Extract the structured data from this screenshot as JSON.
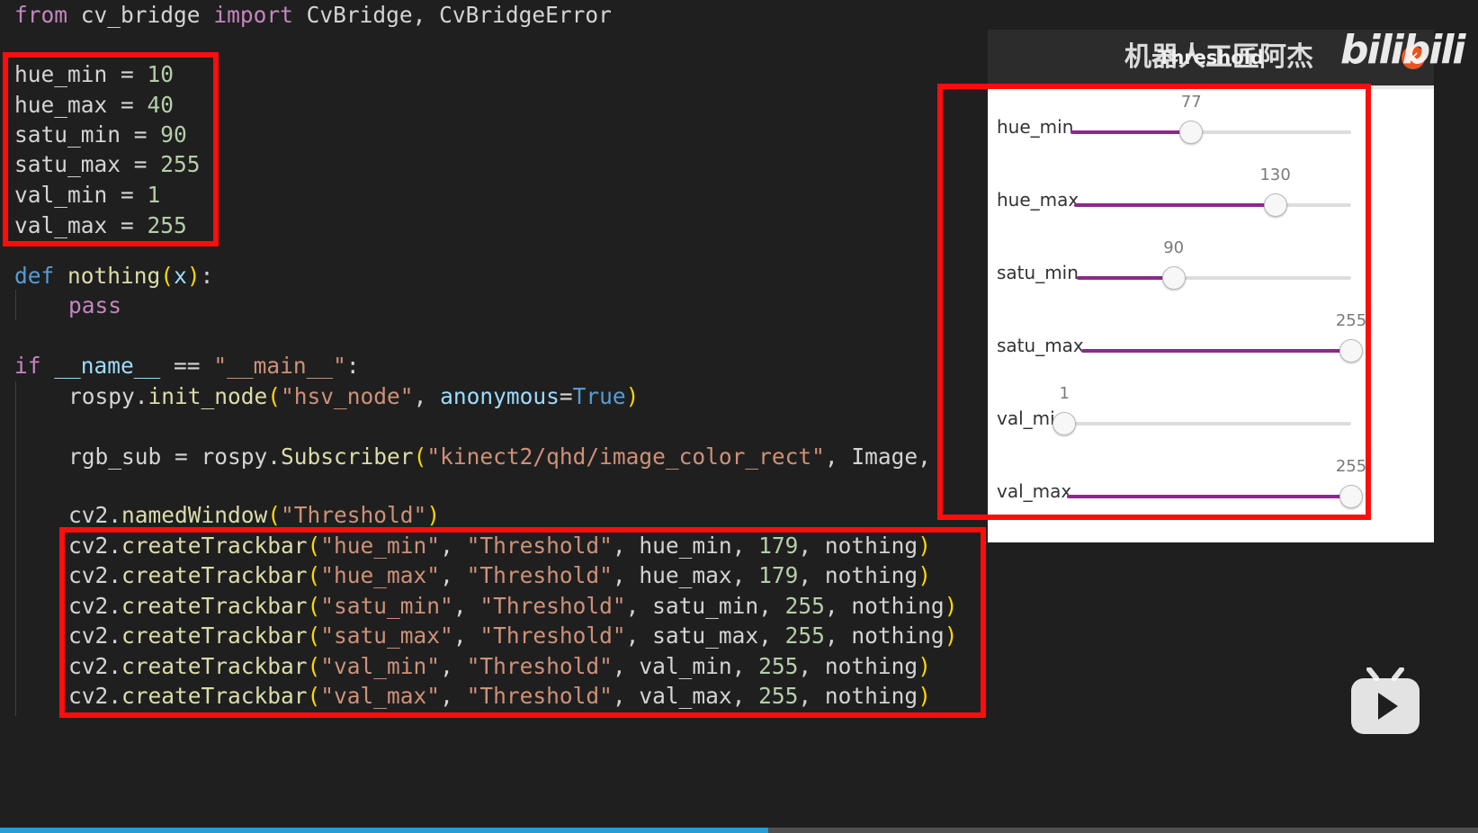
{
  "code": {
    "import_line": {
      "kw_from": "from",
      "module": "cv_bridge",
      "kw_import": "import",
      "names": "CvBridge, CvBridgeError"
    },
    "assignments": [
      {
        "name": "hue_min",
        "op": " = ",
        "value": "10"
      },
      {
        "name": "hue_max",
        "op": " = ",
        "value": "40"
      },
      {
        "name": "satu_min",
        "op": " = ",
        "value": "90"
      },
      {
        "name": "satu_max",
        "op": " = ",
        "value": "255"
      },
      {
        "name": "val_min",
        "op": " = ",
        "value": "1"
      },
      {
        "name": "val_max",
        "op": " = ",
        "value": "255"
      }
    ],
    "def_line": {
      "kw": "def",
      "fn": "nothing",
      "param": "x"
    },
    "pass_line": "pass",
    "if_line": {
      "kw": "if",
      "name_var": "__name__",
      "op": " == ",
      "str": "\"__main__\"",
      "colon": ":"
    },
    "init_node": {
      "obj": "rospy.",
      "fn": "init_node",
      "str": "\"hsv_node\"",
      "kwarg": "anonymous",
      "eq": "=",
      "const": "True"
    },
    "subscriber": {
      "var": "rgb_sub",
      "op": " = ",
      "obj": "rospy.",
      "fn": "Subscriber",
      "str": "\"kinect2/qhd/image_color_rect\"",
      "tail": ", Image,"
    },
    "named_window": {
      "obj": "cv2.",
      "fn": "namedWindow",
      "str": "\"Threshold\""
    },
    "trackbars": [
      {
        "name_str": "\"hue_min\"",
        "win_str": "\"Threshold\"",
        "var": "hue_min",
        "max": "179",
        "cb": "nothing"
      },
      {
        "name_str": "\"hue_max\"",
        "win_str": "\"Threshold\"",
        "var": "hue_max",
        "max": "179",
        "cb": "nothing"
      },
      {
        "name_str": "\"satu_min\"",
        "win_str": "\"Threshold\"",
        "var": "satu_min",
        "max": "255",
        "cb": "nothing"
      },
      {
        "name_str": "\"satu_max\"",
        "win_str": "\"Threshold\"",
        "var": "satu_max",
        "max": "255",
        "cb": "nothing"
      },
      {
        "name_str": "\"val_min\"",
        "win_str": "\"Threshold\"",
        "var": "val_min",
        "max": "255",
        "cb": "nothing"
      },
      {
        "name_str": "\"val_max\"",
        "win_str": "\"Threshold\"",
        "var": "val_max",
        "max": "255",
        "cb": "nothing"
      }
    ],
    "trackbar_fn": "createTrackbar",
    "trackbar_obj": "cv2."
  },
  "cv_window": {
    "title": "Threshold",
    "close_glyph": "✕",
    "sliders": [
      {
        "label": "hue_min",
        "value": 77,
        "max": 179,
        "value_text": "77"
      },
      {
        "label": "hue_max",
        "value": 130,
        "max": 179,
        "value_text": "130"
      },
      {
        "label": "satu_min",
        "value": 90,
        "max": 255,
        "value_text": "90"
      },
      {
        "label": "satu_max",
        "value": 255,
        "max": 255,
        "value_text": "255"
      },
      {
        "label": "val_min",
        "value": 1,
        "max": 255,
        "value_text": "1"
      },
      {
        "label": "val_max",
        "value": 255,
        "max": 255,
        "value_text": "255"
      }
    ]
  },
  "watermark": {
    "text": "机器人工匠阿杰",
    "logo": "bilibili"
  },
  "player": {
    "progress": 0.52,
    "icon": "bilibili-tv-icon"
  },
  "colors": {
    "highlight_box": "#ff0d0d",
    "slider_fill": "#8a2a8a",
    "progress": "#1ea0d8"
  }
}
